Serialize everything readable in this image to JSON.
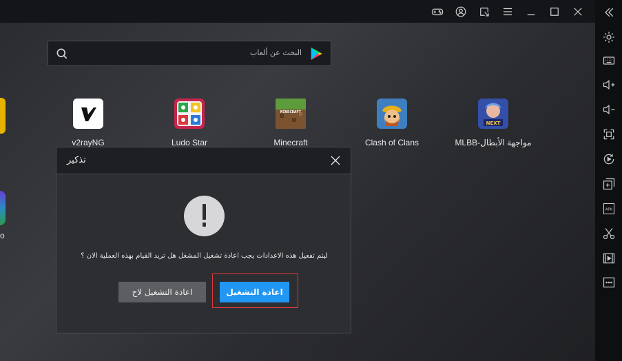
{
  "titlebar": {
    "icons": [
      "gamepad-icon",
      "account-icon",
      "resize-icon",
      "menu-icon",
      "minimize-icon",
      "maximize-icon",
      "close-icon"
    ]
  },
  "sidebar": {
    "icons": [
      "collapse-icon",
      "settings-icon",
      "keyboard-icon",
      "volume-up-icon",
      "volume-down-icon",
      "fullscreen-icon",
      "rotate-icon",
      "add-instance-icon",
      "apk-icon",
      "screenshot-icon",
      "record-icon",
      "more-icon"
    ]
  },
  "search": {
    "placeholder": "البحث عن ألعاب"
  },
  "apps": [
    {
      "label": "v2rayNG"
    },
    {
      "label": "Ludo Star"
    },
    {
      "label": "Minecraft"
    },
    {
      "label": "Clash of Clans"
    },
    {
      "label": "MLBB-مواجهة الأبطال"
    }
  ],
  "edge_label": "o",
  "dialog": {
    "title": "تذكير",
    "message": "ليتم تفعيل هذه الاعدادات يجب اعادة تشغيل المشغل هل تريد القيام بهذه العملية الان ؟",
    "later_label": "اعادة التشغيل لاح",
    "restart_label": "اعادة التشغيل"
  },
  "colors": {
    "accent": "#2196f3",
    "highlight": "#e23a3a"
  }
}
